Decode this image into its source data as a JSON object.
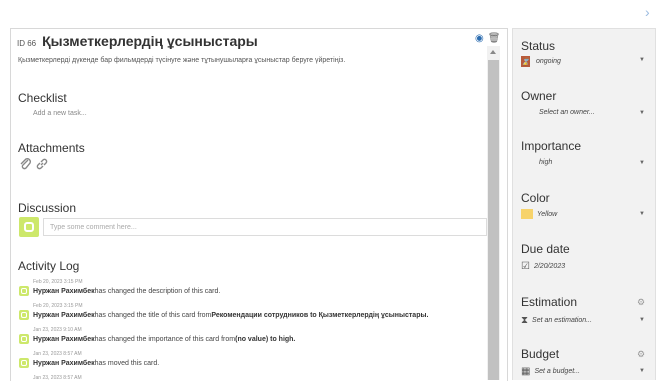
{
  "card": {
    "id": "ID 66",
    "title": "Қызметкерлердің ұсыныстары",
    "description": "Қызметкерлерді дүкенде бар фильмдерді түсінуге және тұтынушыларға ұсыныстар беруге үйретіңіз."
  },
  "checklist": {
    "heading": "Checklist",
    "placeholder": "Add a new task..."
  },
  "attachments": {
    "heading": "Attachments"
  },
  "discussion": {
    "heading": "Discussion",
    "placeholder": "Type some comment here..."
  },
  "activity": {
    "heading": "Activity Log",
    "entries": [
      {
        "time": "Feb 20, 2023 3:15 PM",
        "user": "Нуржан Рахимбек",
        "text": " has changed the description of this card.",
        "extra": ""
      },
      {
        "time": "Feb 20, 2023 3:15 PM",
        "user": "Нуржан Рахимбек",
        "text": " has changed the title of this card from ",
        "extra": "Рекомендации сотрудников to Қызметкерлердің ұсыныстары."
      },
      {
        "time": "Jan 23, 2023 9:10 AM",
        "user": "Нуржан Рахимбек",
        "text": " has changed the importance of this card from ",
        "extra": "(no value) to high."
      },
      {
        "time": "Jan 23, 2023 8:57 AM",
        "user": "Нуржан Рахимбек",
        "text": " has moved this card.",
        "extra": ""
      },
      {
        "time": "Jan 23, 2023 8:57 AM",
        "user": "",
        "text": "",
        "extra": ""
      }
    ]
  },
  "sidebar": {
    "status": {
      "label": "Status",
      "value": "ongoing"
    },
    "owner": {
      "label": "Owner",
      "value": "Select an owner..."
    },
    "importance": {
      "label": "Importance",
      "value": "high"
    },
    "color": {
      "label": "Color",
      "value": "Yellow",
      "swatch": "#f7d36b"
    },
    "due": {
      "label": "Due date",
      "value": "2/20/2023"
    },
    "estimation": {
      "label": "Estimation",
      "value": "Set an estimation..."
    },
    "budget": {
      "label": "Budget",
      "value": "Set a budget..."
    }
  }
}
